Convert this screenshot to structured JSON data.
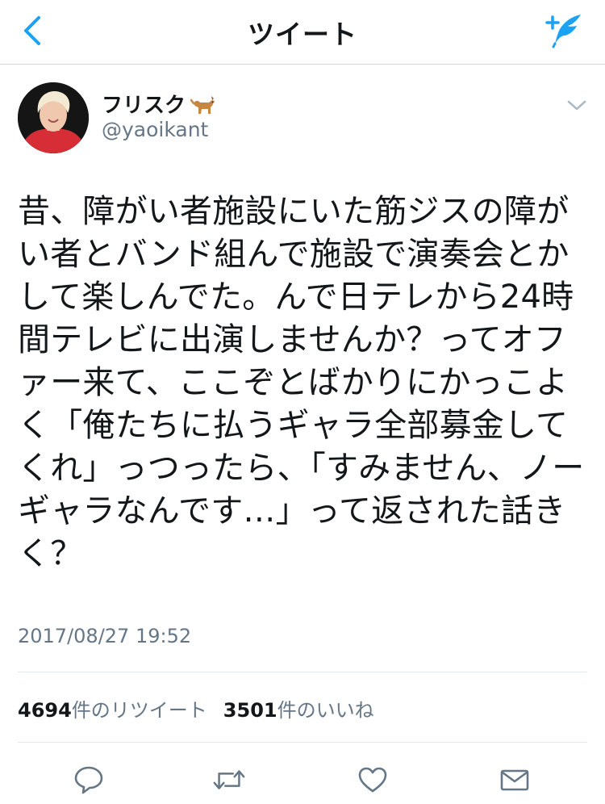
{
  "nav": {
    "title": "ツイート",
    "back_icon": "chevron-left-icon",
    "compose_icon": "compose-feather-icon",
    "accent_color": "#1da1f2"
  },
  "user": {
    "name": "フリスク",
    "name_emoji_icon": "dog-icon",
    "handle": "@yaoikant"
  },
  "tweet": {
    "text": "昔、障がい者施設にいた筋ジスの障がい者とバンド組んで施設で演奏会とかして楽しんでた。んで日テレから24時間テレビに出演しませんか？ってオファー来て、ここぞとばかりにかっこよく「俺たちに払うギャラ全部募金してくれ」っつったら、「すみません、ノーギャラなんです…」って返された話きく？",
    "timestamp": "2017/08/27 19:52"
  },
  "stats": {
    "retweets_count": "4694",
    "retweets_label": "件のリツイート",
    "likes_count": "3501",
    "likes_label": "件のいいね"
  },
  "actions": {
    "reply_icon": "reply-icon",
    "retweet_icon": "retweet-icon",
    "like_icon": "heart-icon",
    "dm_icon": "envelope-icon"
  }
}
